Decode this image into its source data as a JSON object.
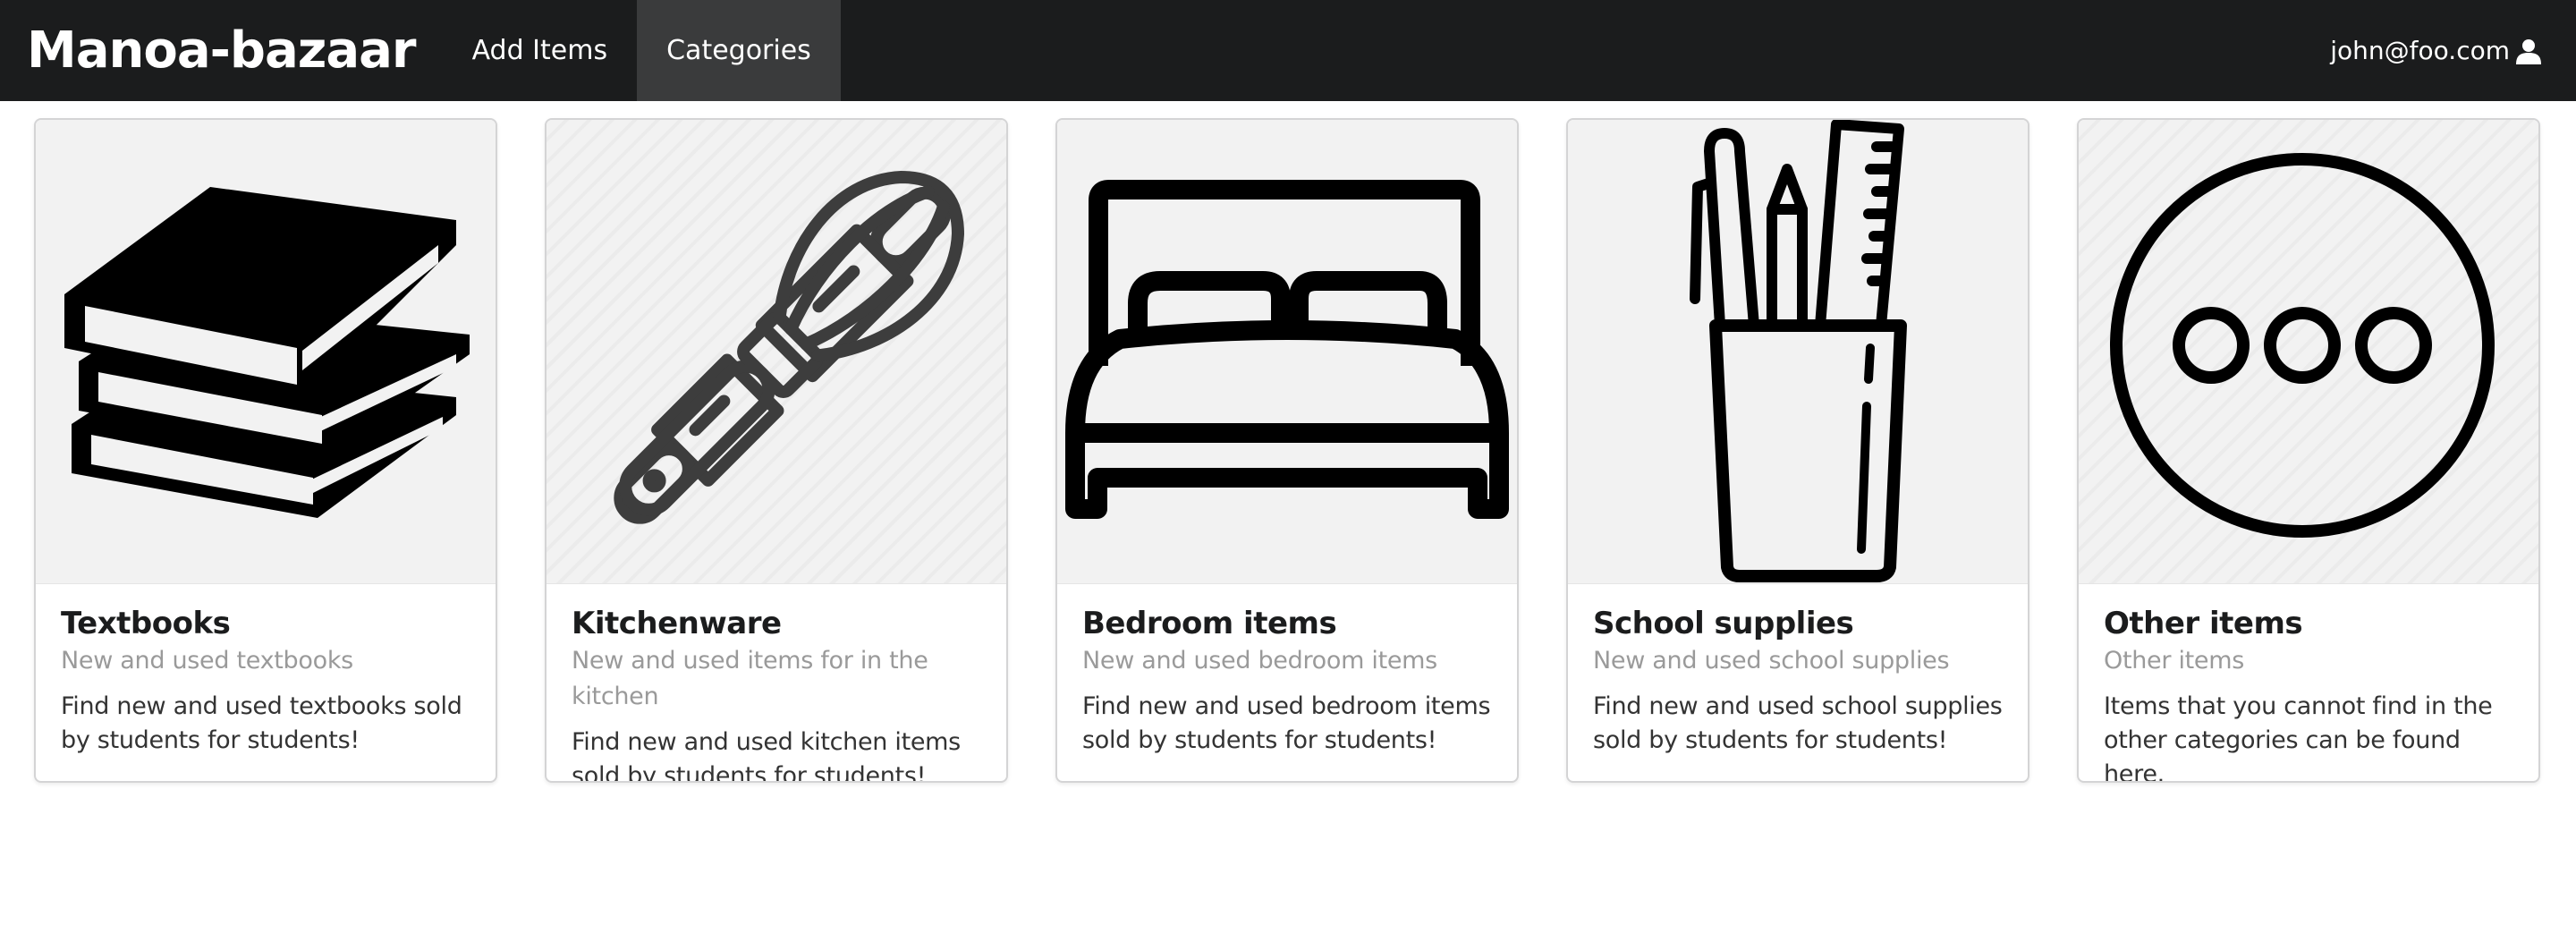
{
  "navbar": {
    "brand": "Manoa-bazaar",
    "items": [
      {
        "label": "Add Items",
        "active": false
      },
      {
        "label": "Categories",
        "active": true
      }
    ],
    "user": "john@foo.com",
    "user_icon": "user-icon"
  },
  "cards": [
    {
      "icon": "books-icon",
      "header": "Textbooks",
      "meta": "New and used textbooks",
      "description": "Find new and used textbooks sold by students for students!"
    },
    {
      "icon": "kitchen-utensils-icon",
      "header": "Kitchenware",
      "meta": "New and used items for in the kitchen",
      "description": "Find new and used kitchen items sold by students for students!"
    },
    {
      "icon": "bed-icon",
      "header": "Bedroom items",
      "meta": "New and used bedroom items",
      "description": "Find new and used bedroom items sold by students for students!"
    },
    {
      "icon": "pencil-cup-icon",
      "header": "School supplies",
      "meta": "New and used school supplies",
      "description": "Find new and used school supplies sold by students for students!"
    },
    {
      "icon": "more-dots-icon",
      "header": "Other items",
      "meta": "Other items",
      "description": "Items that you cannot find in the other categories can be found here."
    }
  ],
  "colors": {
    "navbar_bg": "#1b1c1d",
    "active_nav_bg": "#3a3b3c",
    "card_image_bg": "#f2f2f2",
    "meta_text": "#9a9a9a"
  }
}
